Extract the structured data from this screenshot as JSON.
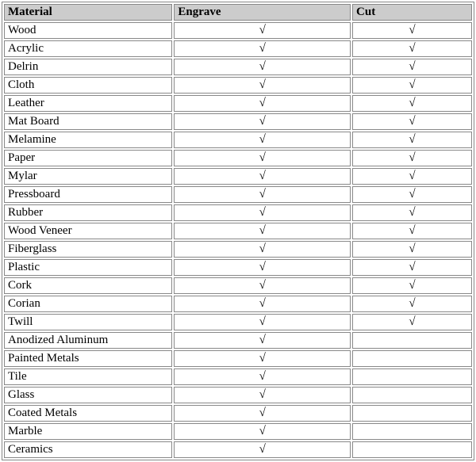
{
  "check_symbol": "√",
  "headers": {
    "material": "Material",
    "engrave": "Engrave",
    "cut": "Cut"
  },
  "rows": [
    {
      "material": "Wood",
      "engrave": true,
      "cut": true
    },
    {
      "material": "Acrylic",
      "engrave": true,
      "cut": true
    },
    {
      "material": "Delrin",
      "engrave": true,
      "cut": true
    },
    {
      "material": "Cloth",
      "engrave": true,
      "cut": true
    },
    {
      "material": "Leather",
      "engrave": true,
      "cut": true
    },
    {
      "material": "Mat Board",
      "engrave": true,
      "cut": true
    },
    {
      "material": "Melamine",
      "engrave": true,
      "cut": true
    },
    {
      "material": "Paper",
      "engrave": true,
      "cut": true
    },
    {
      "material": "Mylar",
      "engrave": true,
      "cut": true
    },
    {
      "material": "Pressboard",
      "engrave": true,
      "cut": true
    },
    {
      "material": "Rubber",
      "engrave": true,
      "cut": true
    },
    {
      "material": "Wood Veneer",
      "engrave": true,
      "cut": true
    },
    {
      "material": "Fiberglass",
      "engrave": true,
      "cut": true
    },
    {
      "material": "Plastic",
      "engrave": true,
      "cut": true
    },
    {
      "material": "Cork",
      "engrave": true,
      "cut": true
    },
    {
      "material": "Corian",
      "engrave": true,
      "cut": true
    },
    {
      "material": "Twill",
      "engrave": true,
      "cut": true
    },
    {
      "material": "Anodized Aluminum",
      "engrave": true,
      "cut": false
    },
    {
      "material": "Painted Metals",
      "engrave": true,
      "cut": false
    },
    {
      "material": "Tile",
      "engrave": true,
      "cut": false
    },
    {
      "material": "Glass",
      "engrave": true,
      "cut": false
    },
    {
      "material": "Coated Metals",
      "engrave": true,
      "cut": false
    },
    {
      "material": "Marble",
      "engrave": true,
      "cut": false
    },
    {
      "material": "Ceramics",
      "engrave": true,
      "cut": false
    }
  ]
}
